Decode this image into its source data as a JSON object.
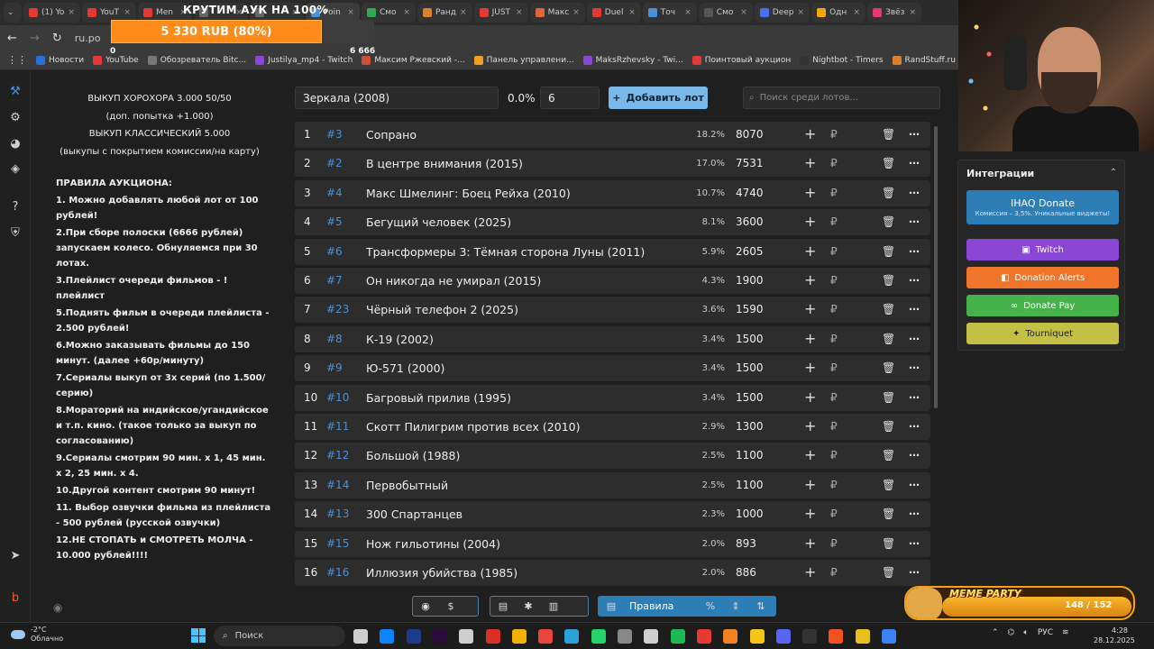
{
  "browser": {
    "tabs": [
      {
        "label": "(1) Yo",
        "color": "#e53935"
      },
      {
        "label": "YouT",
        "color": "#e53935"
      },
      {
        "label": "Men",
        "color": "#e53935"
      },
      {
        "label": "",
        "color": "#666666"
      },
      {
        "label": "",
        "color": "#666666"
      },
      {
        "label": "Poin",
        "color": "#4a90d9"
      },
      {
        "label": "Смо",
        "color": "#34a853"
      },
      {
        "label": "Ранд",
        "color": "#d9822b"
      },
      {
        "label": "JUST",
        "color": "#e53935"
      },
      {
        "label": "Макс",
        "color": "#e0663a"
      },
      {
        "label": "Duel",
        "color": "#e53935"
      },
      {
        "label": "Точ",
        "color": "#4a90d9"
      },
      {
        "label": "Смо",
        "color": "#555555"
      },
      {
        "label": "Deep",
        "color": "#4a6cf7"
      },
      {
        "label": "Одн",
        "color": "#f7a600"
      },
      {
        "label": "Звёз",
        "color": "#e53970"
      }
    ],
    "url": "ru.po",
    "bookmarks": [
      {
        "label": "Новости",
        "color": "#2a6fdb"
      },
      {
        "label": "YouTube",
        "color": "#e53935"
      },
      {
        "label": "Обозреватель Bitc...",
        "color": "#777777"
      },
      {
        "label": "Justilya_mp4 - Twitch",
        "color": "#8a47d6"
      },
      {
        "label": "Максим Ржевский -...",
        "color": "#d04f3a"
      },
      {
        "label": "Панель управлени...",
        "color": "#f0a020"
      },
      {
        "label": "MaksRzhevsky - Twi...",
        "color": "#8a47d6"
      },
      {
        "label": "Поинтовый аукцион",
        "color": "#e53935"
      },
      {
        "label": "Nightbot - Timers",
        "color": "#333333"
      },
      {
        "label": "RandStuff.ru - Гене...",
        "color": "#d9822b"
      },
      {
        "label": "StreamElements - M...",
        "color": "#5b4ae8"
      }
    ]
  },
  "overlay": {
    "title": "КРУТИМ АУК НА 100%",
    "bar_text": "5 330 RUB (80%)",
    "progress": 0.8,
    "start": "0",
    "goal": "6 666"
  },
  "rules": {
    "center_lines": [
      "ВЫКУП ХОРОХОРА 3.000 50/50",
      "(доп. попытка +1.000)",
      "ВЫКУП КЛАССИЧЕСКИЙ 5.000",
      "(выкупы с покрытием комиссии/на карту)"
    ],
    "heading": "ПРАВИЛА АУКЦИОНА:",
    "items": [
      "1. Можно добавлять любой лот от 100 рублей!",
      "2.При сборе полоски (6666 рублей) запускаем колесо. Обнуляемся при 30 лотах.",
      "3.Плейлист очереди фильмов - !плейлист",
      "5.Поднять фильм в очереди плейлиста - 2.500 рублей!",
      "6.Можно заказывать фильмы до 150 минут. (далее +60р/минуту)",
      "7.Сериалы выкуп от 3х серий (по 1.500/серию)",
      "8.Мораторий на индийское/угандийское и т.п. кино. (такое только за выкуп по согласованию)",
      "9.Сериалы смотрим 90 мин. х 1, 45 мин. х 2, 25 мин. х 4.",
      "10.Другой контент смотрим 90 минут!",
      "11. Выбор озвучки фильма из плейлиста - 500 рублей (русской озвучки)",
      "12.НЕ СТОПАТЬ и СМОТРЕТЬ МОЛЧА - 10.000 рублей!!!!"
    ]
  },
  "controls": {
    "lot_name": "Зеркала (2008)",
    "percent": "0.0%",
    "amount": "6",
    "add_label": "Добавить лот",
    "search_placeholder": "Поиск среди лотов..."
  },
  "lots": [
    {
      "n": "1",
      "id": "#3",
      "title": "Сопрано",
      "pct": "18.2%",
      "amount": "8070"
    },
    {
      "n": "2",
      "id": "#2",
      "title": "В центре внимания (2015)",
      "pct": "17.0%",
      "amount": "7531"
    },
    {
      "n": "3",
      "id": "#4",
      "title": "Макс Шмелинг: Боец Рейха (2010)",
      "pct": "10.7%",
      "amount": "4740"
    },
    {
      "n": "4",
      "id": "#5",
      "title": "Бегущий человек (2025)",
      "pct": "8.1%",
      "amount": "3600"
    },
    {
      "n": "5",
      "id": "#6",
      "title": "Трансформеры 3: Тёмная сторона Луны (2011)",
      "pct": "5.9%",
      "amount": "2605"
    },
    {
      "n": "6",
      "id": "#7",
      "title": "Он никогда не умирал (2015)",
      "pct": "4.3%",
      "amount": "1900"
    },
    {
      "n": "7",
      "id": "#23",
      "title": "Чёрный телефон 2 (2025)",
      "pct": "3.6%",
      "amount": "1590"
    },
    {
      "n": "8",
      "id": "#8",
      "title": "К-19 (2002)",
      "pct": "3.4%",
      "amount": "1500"
    },
    {
      "n": "9",
      "id": "#9",
      "title": "Ю-571 (2000)",
      "pct": "3.4%",
      "amount": "1500"
    },
    {
      "n": "10",
      "id": "#10",
      "title": "Багровый прилив (1995)",
      "pct": "3.4%",
      "amount": "1500"
    },
    {
      "n": "11",
      "id": "#11",
      "title": "Скотт Пилигрим против всех (2010)",
      "pct": "2.9%",
      "amount": "1300"
    },
    {
      "n": "12",
      "id": "#12",
      "title": "Большой (1988)",
      "pct": "2.5%",
      "amount": "1100"
    },
    {
      "n": "13",
      "id": "#14",
      "title": "Первобытный",
      "pct": "2.5%",
      "amount": "1100"
    },
    {
      "n": "14",
      "id": "#13",
      "title": "300 Спартанцев",
      "pct": "2.3%",
      "amount": "1000"
    },
    {
      "n": "15",
      "id": "#15",
      "title": "Нож гильотины (2004)",
      "pct": "2.0%",
      "amount": "893"
    },
    {
      "n": "16",
      "id": "#16",
      "title": "Иллюзия убийства (1985)",
      "pct": "2.0%",
      "amount": "886"
    }
  ],
  "integrations": {
    "title": "Интеграции",
    "ihaq": "IHAQ Donate",
    "ihaq_sub": "Комиссия – 3,5%. Уникальные виджеты!",
    "twitch": "Twitch",
    "donation_alerts": "Donation Alerts",
    "donate_pay": "Donate Pay",
    "tourniquet": "Tourniquet"
  },
  "toolbar": {
    "rules_label": "Правила"
  },
  "meme_party": {
    "title": "MEME PARTY",
    "count": "148 / 152"
  },
  "taskbar": {
    "temp": "-2°C",
    "weather": "Облачно",
    "search": "Поиск",
    "lang": "РУС",
    "time": "4:28",
    "date": "28.12.2025"
  }
}
